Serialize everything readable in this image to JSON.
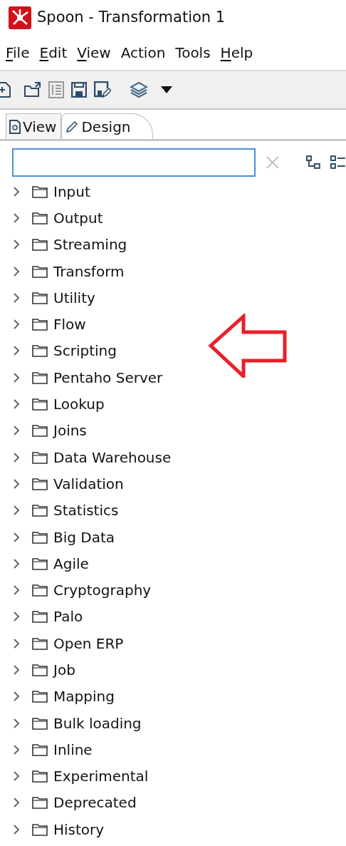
{
  "window": {
    "title": "Spoon - Transformation 1"
  },
  "menu": [
    {
      "label": "File",
      "underline_first": true
    },
    {
      "label": "Edit",
      "underline_first": true
    },
    {
      "label": "View",
      "underline_first": true
    },
    {
      "label": "Action",
      "underline_first": false
    },
    {
      "label": "Tools",
      "underline_first": false
    },
    {
      "label": "Help",
      "underline_first": true
    }
  ],
  "tabs": [
    {
      "label": "View",
      "kind": "view",
      "selected": false
    },
    {
      "label": "Design",
      "kind": "design",
      "selected": true
    }
  ],
  "tree": [
    {
      "label": "Input",
      "expanded": false
    },
    {
      "label": "Output",
      "expanded": false
    },
    {
      "label": "Streaming",
      "expanded": false
    },
    {
      "label": "Transform",
      "expanded": false
    },
    {
      "label": "Utility",
      "expanded": false
    },
    {
      "label": "Flow",
      "expanded": false
    },
    {
      "label": "Scripting",
      "expanded": false
    },
    {
      "label": "Pentaho Server",
      "expanded": false
    },
    {
      "label": "Lookup",
      "expanded": false
    },
    {
      "label": "Joins",
      "expanded": false
    },
    {
      "label": "Data Warehouse",
      "expanded": false
    },
    {
      "label": "Validation",
      "expanded": false
    },
    {
      "label": "Statistics",
      "expanded": false
    },
    {
      "label": "Big Data",
      "expanded": false
    },
    {
      "label": "Agile",
      "expanded": false
    },
    {
      "label": "Cryptography",
      "expanded": false
    },
    {
      "label": "Palo",
      "expanded": false
    },
    {
      "label": "Open ERP",
      "expanded": false
    },
    {
      "label": "Job",
      "expanded": false
    },
    {
      "label": "Mapping",
      "expanded": false
    },
    {
      "label": "Bulk loading",
      "expanded": false
    },
    {
      "label": "Inline",
      "expanded": false
    },
    {
      "label": "Experimental",
      "expanded": false
    },
    {
      "label": "Deprecated",
      "expanded": false
    },
    {
      "label": "History",
      "expanded": false
    }
  ]
}
